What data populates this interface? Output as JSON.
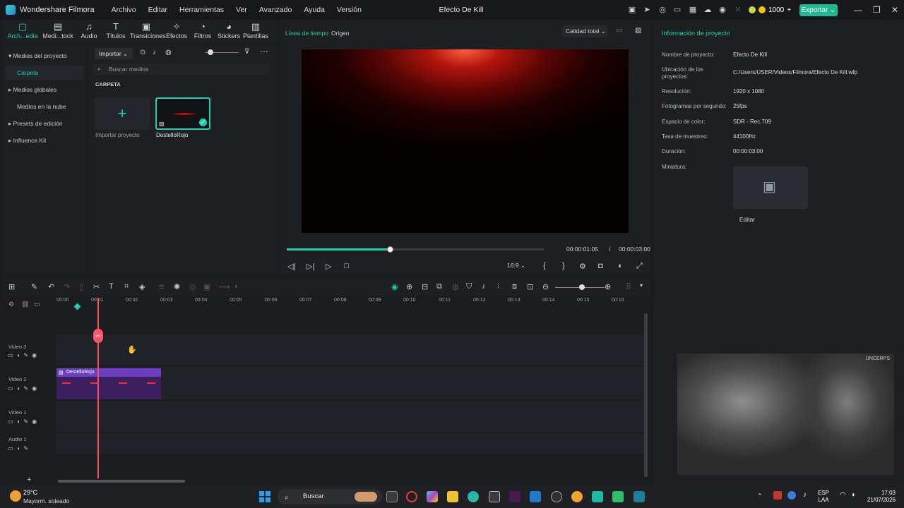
{
  "titlebar": {
    "app_name": "Wondershare Filmora",
    "menu": [
      "Archivo",
      "Editar",
      "Herramientas",
      "Ver",
      "Avanzado",
      "Ayuda",
      "Versión"
    ],
    "window_title": "Efecto De Kill",
    "coins": "1000",
    "export_label": "Exportar"
  },
  "media_tabs": [
    {
      "label": "Arch...edia",
      "icon": "media-icon"
    },
    {
      "label": "Medi...tock",
      "icon": "stock-media-icon"
    },
    {
      "label": "Audio",
      "icon": "audio-icon"
    },
    {
      "label": "Títulos",
      "icon": "titles-icon"
    },
    {
      "label": "Transiciones",
      "icon": "transitions-icon"
    },
    {
      "label": "Efectos",
      "icon": "effects-icon"
    },
    {
      "label": "Filtros",
      "icon": "filters-icon"
    },
    {
      "label": "Stickers",
      "icon": "stickers-icon"
    },
    {
      "label": "Plantillas",
      "icon": "templates-icon"
    }
  ],
  "sidebar": {
    "items": [
      "Medios del proyecto",
      "Carpeta",
      "Medios globales",
      "Medios en la nube",
      "Presets de edición",
      "Influence Kit"
    ]
  },
  "media_panel": {
    "import_label": "Importar",
    "search_placeholder": "Buscar medios",
    "folder_title": "CARPETA",
    "import_item_label": "Importar proyecto",
    "clip_name": "DestelloRojo"
  },
  "preview": {
    "tab_timeline": "Línea de tiempo",
    "tab_source": "Origen",
    "quality": "Calidad total",
    "current_time": "00:00:01:05",
    "separator": "/",
    "total_time": "00:00:03:00",
    "progress_fraction": 0.4,
    "aspect": "16:9"
  },
  "project_info": {
    "heading": "Información de proyecto",
    "fields": [
      {
        "label": "Nombre de proyecto:",
        "value": "Efecto De Kill"
      },
      {
        "label": "Ubicación de los proyectos:",
        "value": "C:/Users/USER/Videos/Filmora/Efecto De Kill.wfp"
      },
      {
        "label": "Resolución:",
        "value": "1920 x 1080"
      },
      {
        "label": "Fotogramas por segundo:",
        "value": "25fps"
      },
      {
        "label": "Espacio de color:",
        "value": "SDR - Rec.709"
      },
      {
        "label": "Tasa de muestreo:",
        "value": "44100Hz"
      },
      {
        "label": "Duración:",
        "value": "00:00:03:00"
      },
      {
        "label": "Miniatura:",
        "value": ""
      }
    ],
    "edit_label": "Editar"
  },
  "timeline": {
    "ruler_ticks": [
      "00:00",
      "00:01",
      "00:02",
      "00:03",
      "00:04",
      "00:05",
      "00:06",
      "00:07",
      "00:08",
      "00:09",
      "00:10",
      "00:11",
      "00:12",
      "00:13",
      "00:14",
      "00:15",
      "00:16"
    ],
    "tracks": [
      "Video 3",
      "Video 2",
      "Video 1",
      "Audio 1"
    ],
    "clip_label": "DestelloRojo"
  },
  "webcam": {
    "watermark": "UNCERPS"
  },
  "taskbar": {
    "temperature": "29°C",
    "weather": "Mayorm. soleado",
    "search": "Buscar",
    "language": "ESP",
    "layout": "LAA",
    "time": "17:03",
    "date": "21/07/2026"
  }
}
